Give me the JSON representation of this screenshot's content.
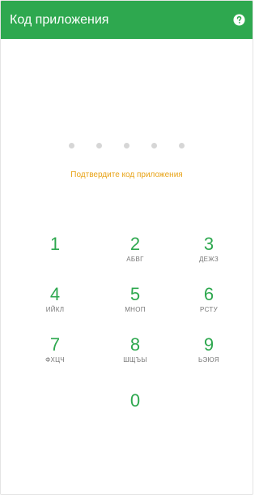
{
  "header": {
    "title": "Код приложения",
    "help_icon": "question-circle-icon",
    "background_color": "#2ea84f"
  },
  "pin": {
    "length": 5,
    "filled": 0,
    "prompt": "Подтвердите код приложения",
    "prompt_color": "#e8a317"
  },
  "keypad": {
    "keys": [
      {
        "digit": "1",
        "letters": ""
      },
      {
        "digit": "2",
        "letters": "АБВГ"
      },
      {
        "digit": "3",
        "letters": "ДЕЖЗ"
      },
      {
        "digit": "4",
        "letters": "ИЙКЛ"
      },
      {
        "digit": "5",
        "letters": "МНОП"
      },
      {
        "digit": "6",
        "letters": "РСТУ"
      },
      {
        "digit": "7",
        "letters": "ФХЦЧ"
      },
      {
        "digit": "8",
        "letters": "ШЩЪЫ"
      },
      {
        "digit": "9",
        "letters": "ЬЭЮЯ"
      },
      {
        "digit": "0",
        "letters": ""
      }
    ],
    "digit_color": "#2ea84f"
  }
}
